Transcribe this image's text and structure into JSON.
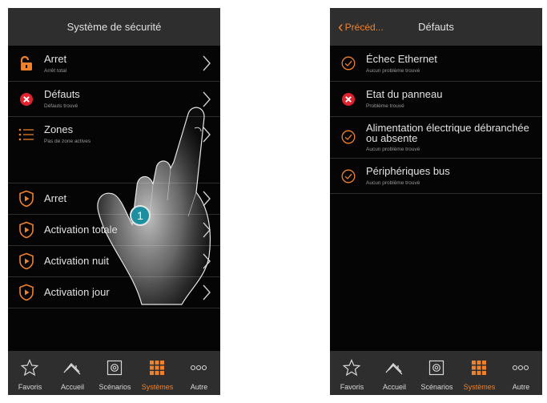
{
  "left_screen": {
    "title": "Système de sécurité",
    "rows": [
      {
        "title": "Arret",
        "subtitle": "Arrêt total",
        "icon": "open-padlock-icon"
      },
      {
        "title": "Défauts",
        "subtitle": "Défauts trouvé",
        "icon": "error-x-icon"
      },
      {
        "title": "Zones",
        "subtitle": "Pas de zone actives",
        "icon": "zones-list-icon"
      },
      {
        "title": "Arret",
        "subtitle": "",
        "icon": "shield-play-icon"
      },
      {
        "title": "Activation totale",
        "subtitle": "",
        "icon": "shield-play-icon"
      },
      {
        "title": "Activation nuit",
        "subtitle": "",
        "icon": "shield-play-icon"
      },
      {
        "title": "Activation jour",
        "subtitle": "",
        "icon": "shield-play-icon"
      }
    ],
    "callout_number": "1"
  },
  "right_screen": {
    "back_label": "Précéd...",
    "title": "Défauts",
    "rows": [
      {
        "title": "Échec Ethernet",
        "subtitle": "Aucun problème trouvé",
        "icon": "check-circle-icon"
      },
      {
        "title": "Etat du panneau",
        "subtitle": "Problème trouvé",
        "icon": "error-x-icon"
      },
      {
        "title": "Alimentation électrique débranchée",
        "title2": "ou absente",
        "subtitle": "Aucun problème trouvé",
        "icon": "check-circle-icon"
      },
      {
        "title": "Périphériques bus",
        "subtitle": "Aucun problème trouvé",
        "icon": "check-circle-icon"
      }
    ]
  },
  "tabbar": {
    "tabs": [
      {
        "label": "Favoris",
        "icon": "star-icon"
      },
      {
        "label": "Accueil",
        "icon": "house-icon"
      },
      {
        "label": "Scénarios",
        "icon": "scenario-icon"
      },
      {
        "label": "Systèmes",
        "icon": "grid-icon",
        "active": true
      },
      {
        "label": "Autre",
        "icon": "more-dots-icon"
      }
    ]
  },
  "colors": {
    "accent": "#f0812b",
    "error": "#e0222e",
    "header_bg": "#2e2e2e",
    "screen_bg": "#050505",
    "callout": "#1e8fa0"
  }
}
